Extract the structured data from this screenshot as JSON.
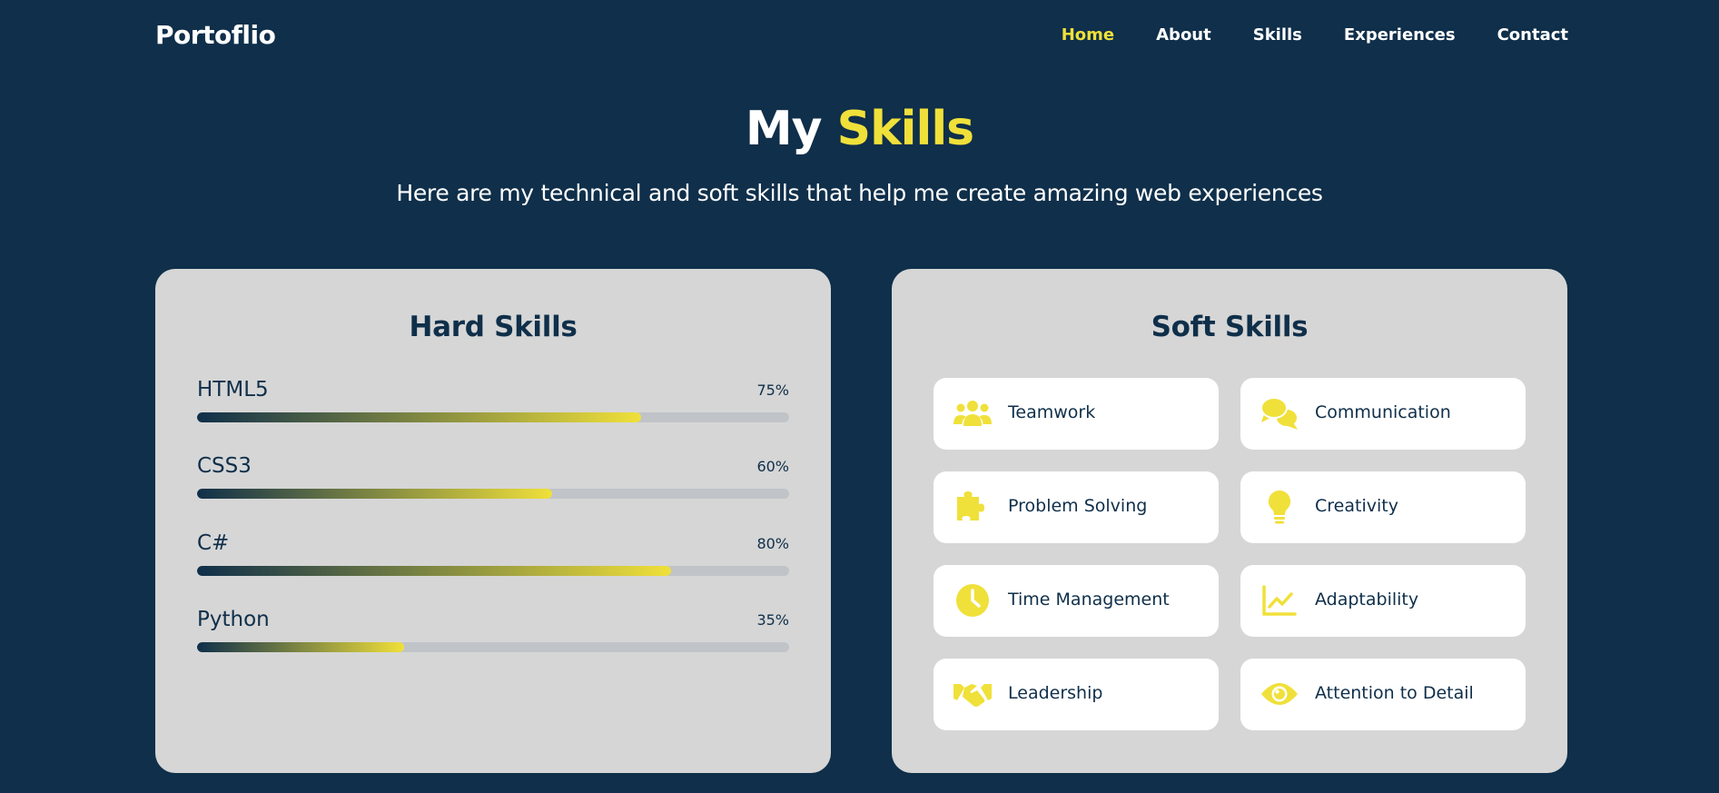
{
  "nav": {
    "logo": "Portoflio",
    "links": [
      "Home",
      "About",
      "Skills",
      "Experiences",
      "Contact"
    ],
    "active": "Home"
  },
  "hero": {
    "title_plain": "My",
    "title_accent": "Skills",
    "subtitle": "Here are my technical and soft skills that help me create amazing web experiences"
  },
  "hard_skills": {
    "title": "Hard Skills",
    "items": [
      {
        "name": "HTML5",
        "percent_label": "75%",
        "level": 75
      },
      {
        "name": "CSS3",
        "percent_label": "60%",
        "level": 60
      },
      {
        "name": "C#",
        "percent_label": "80%",
        "level": 80
      },
      {
        "name": "Python",
        "percent_label": "35%",
        "level": 35
      }
    ]
  },
  "soft_skills": {
    "title": "Soft Skills",
    "items": [
      {
        "label": "Teamwork",
        "icon": "users-icon"
      },
      {
        "label": "Communication",
        "icon": "chat-bubbles-icon"
      },
      {
        "label": "Problem Solving",
        "icon": "puzzle-icon"
      },
      {
        "label": "Creativity",
        "icon": "lightbulb-icon"
      },
      {
        "label": "Time Management",
        "icon": "clock-icon"
      },
      {
        "label": "Adaptability",
        "icon": "line-chart-icon"
      },
      {
        "label": "Leadership",
        "icon": "handshake-icon"
      },
      {
        "label": "Attention to Detail",
        "icon": "eye-icon"
      }
    ]
  },
  "colors": {
    "background": "#0f2f4a",
    "accent": "#f0e03a",
    "card": "#d6d6d6",
    "track": "#c0c4c8"
  }
}
